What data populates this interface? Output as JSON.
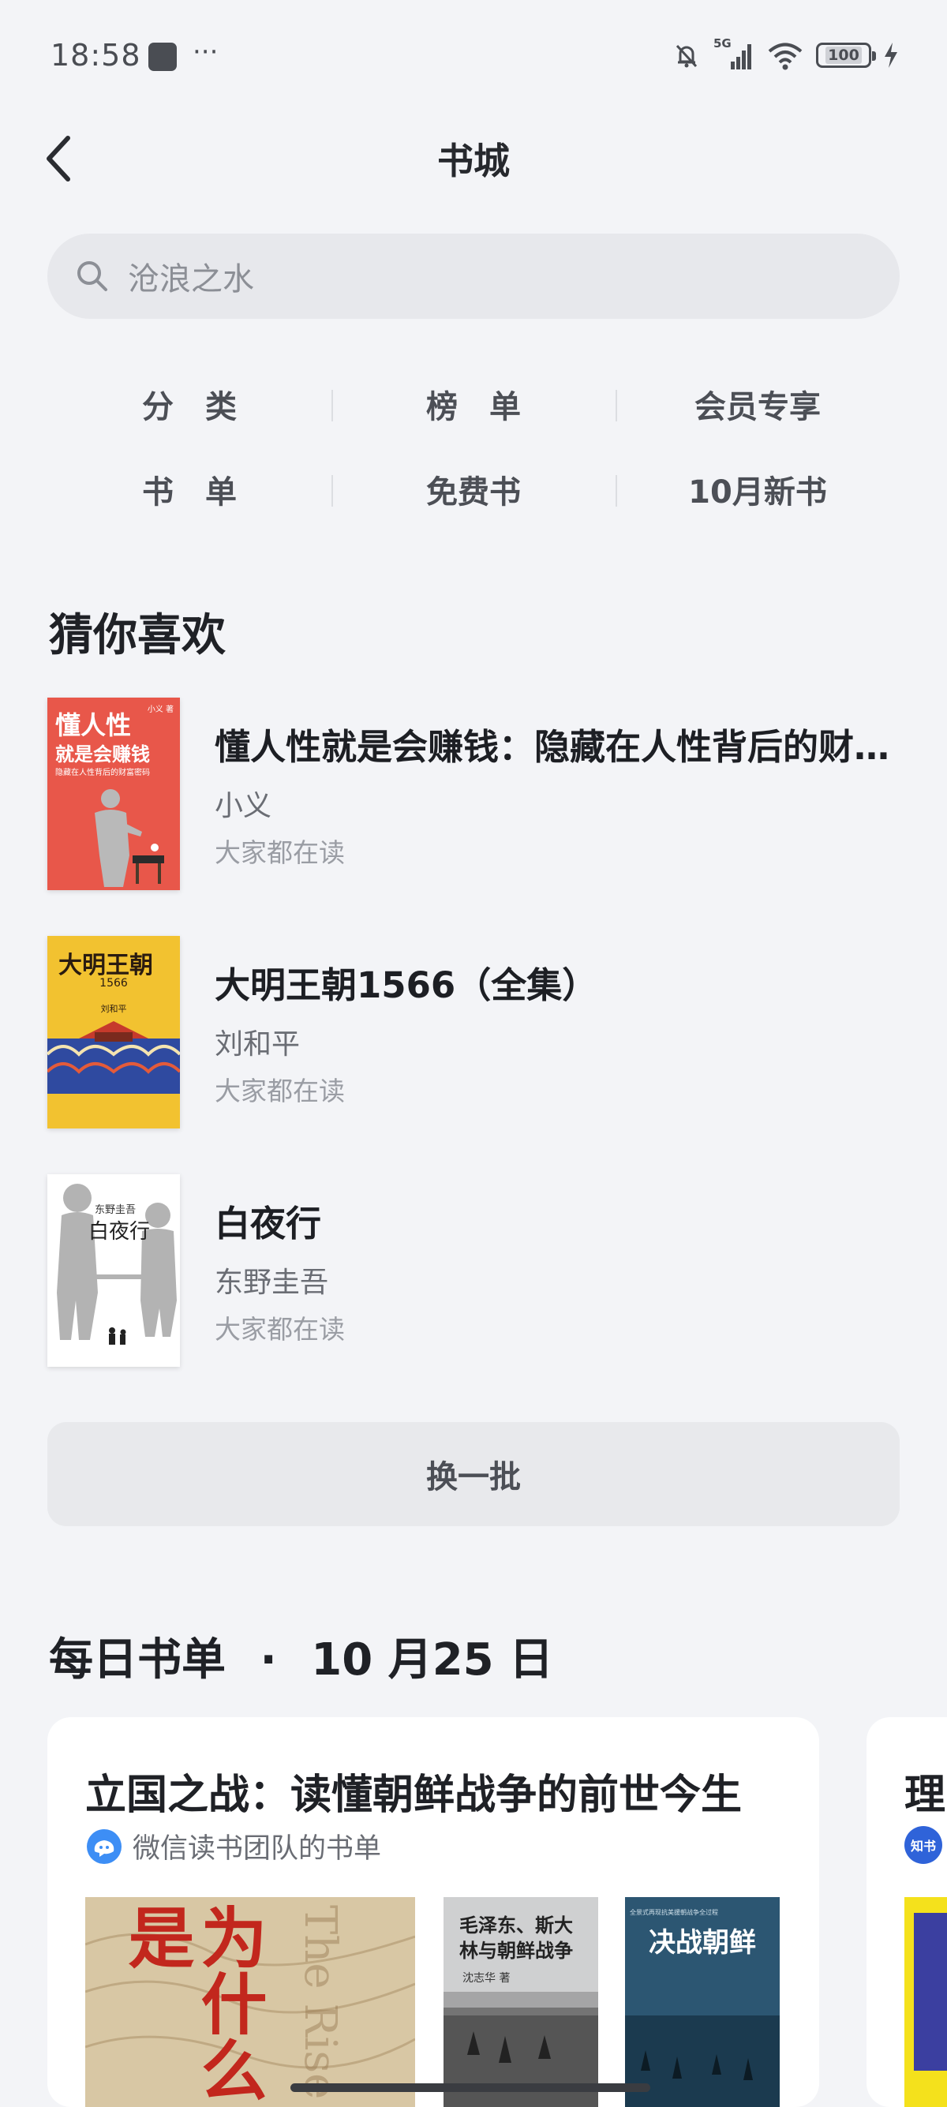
{
  "status_bar": {
    "time": "18:58",
    "more": "···",
    "network": "5G",
    "battery": "100"
  },
  "header": {
    "title": "书城"
  },
  "search": {
    "placeholder": "沧浪之水"
  },
  "categories": [
    {
      "label": "分　类"
    },
    {
      "label": "榜　单"
    },
    {
      "label": "会员专享"
    },
    {
      "label": "书　单"
    },
    {
      "label": "免费书"
    },
    {
      "label": "10月新书"
    }
  ],
  "recommend": {
    "title": "猜你喜欢",
    "books": [
      {
        "title": "懂人性就是会赚钱：隐藏在人性背后的财富密码",
        "author": "小义",
        "note": "大家都在读",
        "cover_title": "懂人性",
        "cover_sub": "就是会赚钱",
        "cover_tag": "隐藏在人性背后的财富密码",
        "cover_author": "小义 著",
        "cover_color": "#e8574a"
      },
      {
        "title": "大明王朝1566（全集）",
        "author": "刘和平",
        "note": "大家都在读",
        "cover_title": "大明王朝",
        "cover_sub": "1566",
        "cover_author": "刘和平",
        "cover_color": "#f2c230"
      },
      {
        "title": "白夜行",
        "author": "东野圭吾",
        "note": "大家都在读",
        "cover_title": "白夜行",
        "cover_author": "东野圭吾",
        "cover_color": "#ffffff"
      }
    ],
    "refresh_label": "换一批"
  },
  "daily": {
    "title": "每日书单",
    "dot": "·",
    "date": "10 月25 日",
    "cards": [
      {
        "title": "立国之战：读懂朝鲜战争的前世今生",
        "source": "微信读书团队的书单",
        "books": [
          {
            "cover_text": "为什么是",
            "cover_english": "The Rise",
            "cover_color": "#d8c7a4"
          },
          {
            "cover_text": "毛泽东、斯大林与朝鲜战争",
            "cover_author": "沈志华 著",
            "cover_color": "#cfd0d1"
          },
          {
            "cover_text": "决战朝鲜",
            "cover_tag": "全景式再现抗美援朝战争全过程",
            "cover_color": "#2c5672"
          }
        ]
      },
      {
        "title": "理",
        "source_icon": "知书",
        "cover_color": "#f4e11c"
      }
    ]
  }
}
